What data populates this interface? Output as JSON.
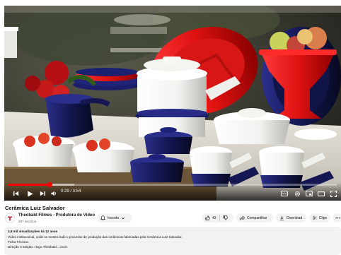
{
  "player": {
    "time_display": "0:29 / 3:54",
    "progress_fraction": 0.124,
    "buffered_fraction": 0.2
  },
  "video": {
    "title": "Cerâmica Luiz Salvador"
  },
  "channel": {
    "name": "Theobald Filmes - Produtora de Vídeo",
    "subscribers": "287 inscritos",
    "subscribe_label": "Inscrito"
  },
  "actions": {
    "likes": "43",
    "share_label": "Compartilhar",
    "download_label": "Download",
    "clips_label": "Clips"
  },
  "description": {
    "views_line": "2,8 mil visualizações  há 12 anos",
    "line1": "Vídeo institucional, onde se mostra todo o processo de produção das cerâmicas fabricadas pela Cerâmica Luiz Salvador.",
    "line2": "Ficha Técnica:",
    "line3": "Direção e Edição: Hugo Theobald",
    "more_label": "...mais"
  },
  "colors": {
    "accent": "#ff0000",
    "text": "#0f0f0f",
    "muted": "#606060",
    "chip": "#f2f2f2"
  },
  "icons": [
    "skip-previous-icon",
    "play-icon",
    "skip-next-icon",
    "volume-icon",
    "subtitles-icon",
    "settings-gear-icon",
    "miniplayer-icon",
    "theater-mode-icon",
    "fullscreen-icon",
    "bell-icon",
    "chevron-down-icon",
    "thumbs-up-icon",
    "thumbs-down-icon",
    "share-icon",
    "download-icon",
    "scissors-icon",
    "more-icon"
  ]
}
